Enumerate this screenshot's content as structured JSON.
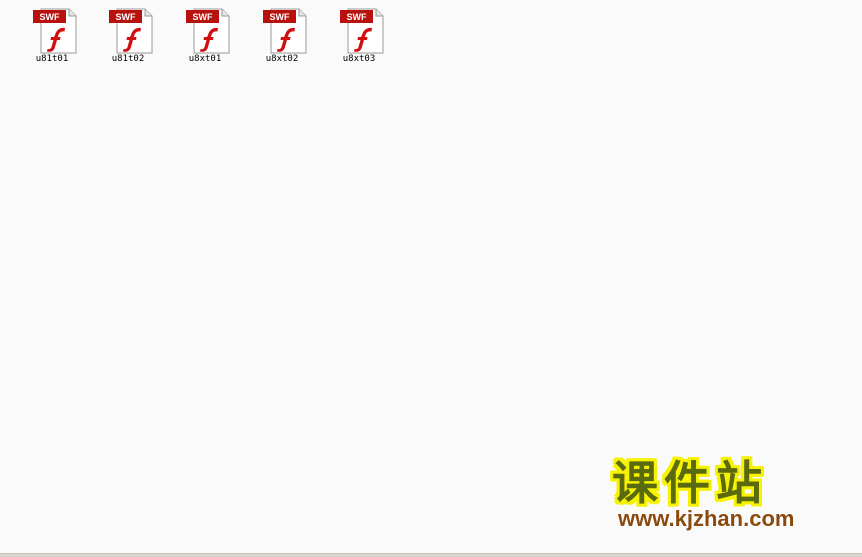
{
  "desktop": {
    "files": [
      {
        "name": "u81t01",
        "type_badge": "SWF",
        "icon": "swf-file-icon"
      },
      {
        "name": "u81t02",
        "type_badge": "SWF",
        "icon": "swf-file-icon"
      },
      {
        "name": "u8xt01",
        "type_badge": "SWF",
        "icon": "swf-file-icon"
      },
      {
        "name": "u8xt02",
        "type_badge": "SWF",
        "icon": "swf-file-icon"
      },
      {
        "name": "u8xt03",
        "type_badge": "SWF",
        "icon": "swf-file-icon"
      }
    ]
  },
  "watermark": {
    "title": "课件站",
    "url": "www.kjzhan.com"
  },
  "colors": {
    "background": "#fafafa",
    "badge_red": "#b8120f",
    "flash_red": "#d01010",
    "watermark_green": "#5a6a0e",
    "watermark_yellow": "#f6f200",
    "watermark_url": "#8a4a0e"
  }
}
